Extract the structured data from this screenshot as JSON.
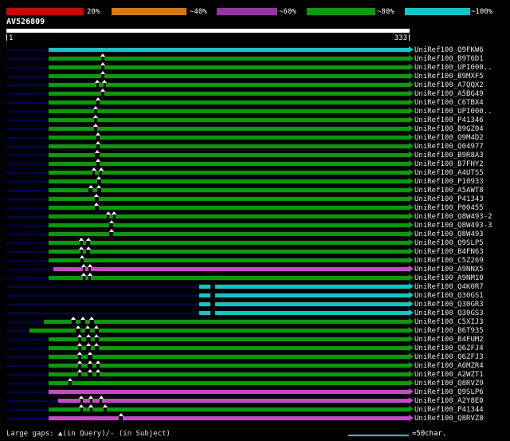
{
  "chart_data": {
    "type": "bar",
    "subtype": "blast-alignment-overview",
    "title": "",
    "query": {
      "name": "AV526809",
      "start": 1,
      "end": 333,
      "start_label": "1",
      "end_label": "333"
    },
    "identity_scale": [
      {
        "label": "20%",
        "color": "#d40000"
      },
      {
        "label": "~40%",
        "color": "#dd7700"
      },
      {
        "label": "~60%",
        "color": "#9933aa"
      },
      {
        "label": "~80%",
        "color": "#00a000"
      },
      {
        "label": "~100%",
        "color": "#00cccc"
      }
    ],
    "colors": {
      "green": "#00a000",
      "cyan": "#00cccc",
      "magenta": "#cc44cc",
      "lead": "#000066",
      "query_bar": "#ffffff"
    },
    "icons": {
      "gap_marker": "triangle-up-icon",
      "hit_end": "arrow-right-icon"
    },
    "rows": [
      {
        "label": "UniRef100_Q9FKW6",
        "color": "cyan",
        "start": 36,
        "end": 333,
        "gaps": []
      },
      {
        "label": "UniRef100_B9T6D1",
        "color": "green",
        "start": 36,
        "end": 333,
        "gaps": [
          {
            "p": 79,
            "w": 3
          }
        ]
      },
      {
        "label": "UniRef100_UPI000..",
        "color": "green",
        "start": 36,
        "end": 333,
        "gaps": [
          {
            "p": 79,
            "w": 3
          }
        ]
      },
      {
        "label": "UniRef100_B9MXF5",
        "color": "green",
        "start": 36,
        "end": 333,
        "gaps": [
          {
            "p": 79,
            "w": 3
          }
        ]
      },
      {
        "label": "UniRef100_A7QQX2",
        "color": "green",
        "start": 36,
        "end": 333,
        "gaps": [
          {
            "p": 75,
            "w": 2
          },
          {
            "p": 81,
            "w": 2
          }
        ]
      },
      {
        "label": "UniRef100_A5BG49",
        "color": "green",
        "start": 36,
        "end": 333,
        "gaps": [
          {
            "p": 79,
            "w": 3
          }
        ]
      },
      {
        "label": "UniRef100_C6TBX4",
        "color": "green",
        "start": 36,
        "end": 333,
        "gaps": [
          {
            "p": 75,
            "w": 3
          }
        ]
      },
      {
        "label": "UniRef100_UPI000..",
        "color": "green",
        "start": 36,
        "end": 333,
        "gaps": [
          {
            "p": 73,
            "w": 3
          }
        ]
      },
      {
        "label": "UniRef100_P41346",
        "color": "green",
        "start": 36,
        "end": 333,
        "gaps": [
          {
            "p": 73,
            "w": 3
          }
        ]
      },
      {
        "label": "UniRef100_B9GZ04",
        "color": "green",
        "start": 36,
        "end": 333,
        "gaps": [
          {
            "p": 73,
            "w": 3
          }
        ]
      },
      {
        "label": "UniRef100_Q9M4D2",
        "color": "green",
        "start": 36,
        "end": 333,
        "gaps": [
          {
            "p": 75,
            "w": 3
          }
        ]
      },
      {
        "label": "UniRef100_Q04977",
        "color": "green",
        "start": 36,
        "end": 333,
        "gaps": [
          {
            "p": 75,
            "w": 3
          }
        ]
      },
      {
        "label": "UniRef100_B9R8A3",
        "color": "green",
        "start": 36,
        "end": 333,
        "gaps": [
          {
            "p": 74,
            "w": 4
          }
        ]
      },
      {
        "label": "UniRef100_B7FHY2",
        "color": "green",
        "start": 36,
        "end": 333,
        "gaps": [
          {
            "p": 75,
            "w": 3
          }
        ]
      },
      {
        "label": "UniRef100_A4UTS5",
        "color": "green",
        "start": 36,
        "end": 333,
        "gaps": [
          {
            "p": 72,
            "w": 2
          },
          {
            "p": 78,
            "w": 2
          }
        ]
      },
      {
        "label": "UniRef100_P10933",
        "color": "green",
        "start": 36,
        "end": 333,
        "gaps": [
          {
            "p": 76,
            "w": 3
          }
        ]
      },
      {
        "label": "UniRef100_A5AWT8",
        "color": "green",
        "start": 36,
        "end": 333,
        "gaps": [
          {
            "p": 69,
            "w": 3
          },
          {
            "p": 76,
            "w": 3
          }
        ]
      },
      {
        "label": "UniRef100_P41343",
        "color": "green",
        "start": 36,
        "end": 333,
        "gaps": [
          {
            "p": 74,
            "w": 3
          }
        ]
      },
      {
        "label": "UniRef100_P00455",
        "color": "green",
        "start": 36,
        "end": 333,
        "gaps": [
          {
            "p": 74,
            "w": 3
          }
        ]
      },
      {
        "label": "UniRef100_Q8W493-2",
        "color": "green",
        "start": 36,
        "end": 333,
        "gaps": [
          {
            "p": 84,
            "w": 2
          },
          {
            "p": 89,
            "w": 2
          }
        ]
      },
      {
        "label": "UniRef100_Q8W493-3",
        "color": "green",
        "start": 36,
        "end": 333,
        "gaps": [
          {
            "p": 86,
            "w": 3
          }
        ]
      },
      {
        "label": "UniRef100_Q8W493",
        "color": "green",
        "start": 36,
        "end": 333,
        "gaps": [
          {
            "p": 86,
            "w": 3
          }
        ]
      },
      {
        "label": "UniRef100_Q9SLP5",
        "color": "green",
        "start": 36,
        "end": 333,
        "gaps": [
          {
            "p": 62,
            "w": 2
          },
          {
            "p": 67,
            "w": 3
          }
        ]
      },
      {
        "label": "UniRef100_B4FN63",
        "color": "green",
        "start": 36,
        "end": 333,
        "gaps": [
          {
            "p": 62,
            "w": 2
          },
          {
            "p": 67,
            "w": 3
          }
        ]
      },
      {
        "label": "UniRef100_C5Z269",
        "color": "green",
        "start": 36,
        "end": 333,
        "gaps": [
          {
            "p": 62,
            "w": 3
          }
        ]
      },
      {
        "label": "UniRef100_A9NNX5",
        "color": "magenta",
        "start": 40,
        "end": 333,
        "gaps": [
          {
            "p": 64,
            "w": 2
          },
          {
            "p": 69,
            "w": 2
          }
        ]
      },
      {
        "label": "UniRef100_A9NM10",
        "color": "green",
        "start": 36,
        "end": 333,
        "gaps": [
          {
            "p": 64,
            "w": 2
          },
          {
            "p": 69,
            "w": 2
          }
        ]
      },
      {
        "label": "UniRef100_Q4K0R7",
        "color": "cyan",
        "start": 160,
        "end": 333,
        "gaps": [
          {
            "p": 169,
            "w": 4,
            "tri": false
          }
        ]
      },
      {
        "label": "UniRef100_Q30GS1",
        "color": "cyan",
        "start": 160,
        "end": 333,
        "gaps": [
          {
            "p": 169,
            "w": 4,
            "tri": false
          }
        ]
      },
      {
        "label": "UniRef100_Q30GR3",
        "color": "cyan",
        "start": 160,
        "end": 333,
        "gaps": [
          {
            "p": 169,
            "w": 4,
            "tri": false
          }
        ]
      },
      {
        "label": "UniRef100_Q30GS3",
        "color": "cyan",
        "start": 160,
        "end": 333,
        "gaps": [
          {
            "p": 169,
            "w": 4,
            "tri": false
          }
        ]
      },
      {
        "label": "UniRef100_C5XIJ3",
        "color": "green",
        "start": 32,
        "end": 333,
        "gaps": [
          {
            "p": 55,
            "w": 3
          },
          {
            "p": 62,
            "w": 4
          },
          {
            "p": 70,
            "w": 3
          }
        ]
      },
      {
        "label": "UniRef100_B6T935",
        "color": "green",
        "start": 20,
        "end": 333,
        "gaps": [
          {
            "p": 58,
            "w": 4
          },
          {
            "p": 66,
            "w": 4
          },
          {
            "p": 74,
            "w": 3
          }
        ]
      },
      {
        "label": "UniRef100_B4FUM2",
        "color": "green",
        "start": 36,
        "end": 333,
        "gaps": [
          {
            "p": 60,
            "w": 3
          },
          {
            "p": 67,
            "w": 4
          },
          {
            "p": 74,
            "w": 3
          }
        ]
      },
      {
        "label": "UniRef100_Q6ZFJ4",
        "color": "green",
        "start": 36,
        "end": 333,
        "gaps": [
          {
            "p": 60,
            "w": 3
          },
          {
            "p": 67,
            "w": 4
          },
          {
            "p": 74,
            "w": 3
          }
        ]
      },
      {
        "label": "UniRef100_Q6ZFJ3",
        "color": "green",
        "start": 36,
        "end": 333,
        "gaps": [
          {
            "p": 60,
            "w": 3
          },
          {
            "p": 68,
            "w": 4
          }
        ]
      },
      {
        "label": "UniRef100_A6MZR4",
        "color": "green",
        "start": 36,
        "end": 333,
        "gaps": [
          {
            "p": 60,
            "w": 3
          },
          {
            "p": 68,
            "w": 4
          },
          {
            "p": 75,
            "w": 3
          }
        ]
      },
      {
        "label": "UniRef100_A2WZT1",
        "color": "green",
        "start": 36,
        "end": 333,
        "gaps": [
          {
            "p": 60,
            "w": 3
          },
          {
            "p": 68,
            "w": 4
          },
          {
            "p": 75,
            "w": 3
          }
        ]
      },
      {
        "label": "UniRef100_Q8RVZ9",
        "color": "green",
        "start": 36,
        "end": 333,
        "gaps": [
          {
            "p": 52,
            "w": 3
          }
        ]
      },
      {
        "label": "UniRef100_Q9SLP6",
        "color": "magenta",
        "start": 36,
        "end": 333,
        "gaps": []
      },
      {
        "label": "UniRef100_A2Y8E0",
        "color": "magenta",
        "start": 44,
        "end": 333,
        "gaps": [
          {
            "p": 62,
            "w": 2
          },
          {
            "p": 70,
            "w": 2
          },
          {
            "p": 78,
            "w": 2
          }
        ]
      },
      {
        "label": "UniRef100_P41344",
        "color": "green",
        "start": 36,
        "end": 333,
        "gaps": [
          {
            "p": 62,
            "w": 2
          },
          {
            "p": 70,
            "w": 2
          },
          {
            "p": 81,
            "w": 3
          }
        ]
      },
      {
        "label": "UniRef100_Q8RVZ8",
        "color": "magenta",
        "start": 36,
        "end": 333,
        "gaps": [
          {
            "p": 94,
            "w": 3
          }
        ]
      }
    ],
    "legend": {
      "gaps_text": "Large gaps: ▲(in Query)/- (in Subject)",
      "scale_text": "=50char.",
      "scale_chars": 50
    }
  }
}
